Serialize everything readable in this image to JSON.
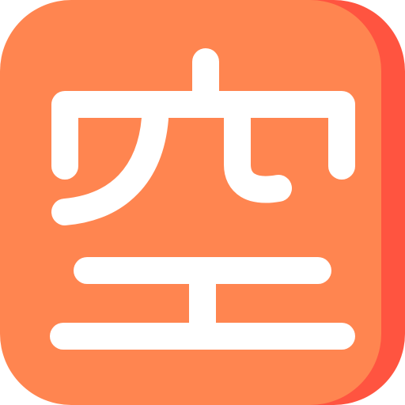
{
  "icon": {
    "name": "sora-kanji-icon",
    "glyph": "空",
    "colors": {
      "tile": "#FF8550",
      "tile_shadow": "#FF5440",
      "glyph": "#FFFFFF"
    }
  }
}
